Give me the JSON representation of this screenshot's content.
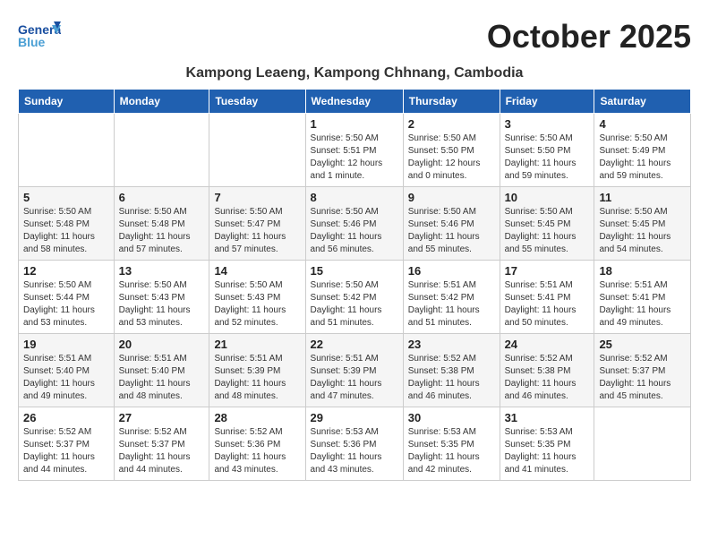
{
  "header": {
    "logo_line1": "General",
    "logo_line2": "Blue",
    "month_title": "October 2025",
    "location": "Kampong Leaeng, Kampong Chhnang, Cambodia"
  },
  "weekdays": [
    "Sunday",
    "Monday",
    "Tuesday",
    "Wednesday",
    "Thursday",
    "Friday",
    "Saturday"
  ],
  "weeks": [
    [
      {
        "day": "",
        "info": ""
      },
      {
        "day": "",
        "info": ""
      },
      {
        "day": "",
        "info": ""
      },
      {
        "day": "1",
        "info": "Sunrise: 5:50 AM\nSunset: 5:51 PM\nDaylight: 12 hours\nand 1 minute."
      },
      {
        "day": "2",
        "info": "Sunrise: 5:50 AM\nSunset: 5:50 PM\nDaylight: 12 hours\nand 0 minutes."
      },
      {
        "day": "3",
        "info": "Sunrise: 5:50 AM\nSunset: 5:50 PM\nDaylight: 11 hours\nand 59 minutes."
      },
      {
        "day": "4",
        "info": "Sunrise: 5:50 AM\nSunset: 5:49 PM\nDaylight: 11 hours\nand 59 minutes."
      }
    ],
    [
      {
        "day": "5",
        "info": "Sunrise: 5:50 AM\nSunset: 5:48 PM\nDaylight: 11 hours\nand 58 minutes."
      },
      {
        "day": "6",
        "info": "Sunrise: 5:50 AM\nSunset: 5:48 PM\nDaylight: 11 hours\nand 57 minutes."
      },
      {
        "day": "7",
        "info": "Sunrise: 5:50 AM\nSunset: 5:47 PM\nDaylight: 11 hours\nand 57 minutes."
      },
      {
        "day": "8",
        "info": "Sunrise: 5:50 AM\nSunset: 5:46 PM\nDaylight: 11 hours\nand 56 minutes."
      },
      {
        "day": "9",
        "info": "Sunrise: 5:50 AM\nSunset: 5:46 PM\nDaylight: 11 hours\nand 55 minutes."
      },
      {
        "day": "10",
        "info": "Sunrise: 5:50 AM\nSunset: 5:45 PM\nDaylight: 11 hours\nand 55 minutes."
      },
      {
        "day": "11",
        "info": "Sunrise: 5:50 AM\nSunset: 5:45 PM\nDaylight: 11 hours\nand 54 minutes."
      }
    ],
    [
      {
        "day": "12",
        "info": "Sunrise: 5:50 AM\nSunset: 5:44 PM\nDaylight: 11 hours\nand 53 minutes."
      },
      {
        "day": "13",
        "info": "Sunrise: 5:50 AM\nSunset: 5:43 PM\nDaylight: 11 hours\nand 53 minutes."
      },
      {
        "day": "14",
        "info": "Sunrise: 5:50 AM\nSunset: 5:43 PM\nDaylight: 11 hours\nand 52 minutes."
      },
      {
        "day": "15",
        "info": "Sunrise: 5:50 AM\nSunset: 5:42 PM\nDaylight: 11 hours\nand 51 minutes."
      },
      {
        "day": "16",
        "info": "Sunrise: 5:51 AM\nSunset: 5:42 PM\nDaylight: 11 hours\nand 51 minutes."
      },
      {
        "day": "17",
        "info": "Sunrise: 5:51 AM\nSunset: 5:41 PM\nDaylight: 11 hours\nand 50 minutes."
      },
      {
        "day": "18",
        "info": "Sunrise: 5:51 AM\nSunset: 5:41 PM\nDaylight: 11 hours\nand 49 minutes."
      }
    ],
    [
      {
        "day": "19",
        "info": "Sunrise: 5:51 AM\nSunset: 5:40 PM\nDaylight: 11 hours\nand 49 minutes."
      },
      {
        "day": "20",
        "info": "Sunrise: 5:51 AM\nSunset: 5:40 PM\nDaylight: 11 hours\nand 48 minutes."
      },
      {
        "day": "21",
        "info": "Sunrise: 5:51 AM\nSunset: 5:39 PM\nDaylight: 11 hours\nand 48 minutes."
      },
      {
        "day": "22",
        "info": "Sunrise: 5:51 AM\nSunset: 5:39 PM\nDaylight: 11 hours\nand 47 minutes."
      },
      {
        "day": "23",
        "info": "Sunrise: 5:52 AM\nSunset: 5:38 PM\nDaylight: 11 hours\nand 46 minutes."
      },
      {
        "day": "24",
        "info": "Sunrise: 5:52 AM\nSunset: 5:38 PM\nDaylight: 11 hours\nand 46 minutes."
      },
      {
        "day": "25",
        "info": "Sunrise: 5:52 AM\nSunset: 5:37 PM\nDaylight: 11 hours\nand 45 minutes."
      }
    ],
    [
      {
        "day": "26",
        "info": "Sunrise: 5:52 AM\nSunset: 5:37 PM\nDaylight: 11 hours\nand 44 minutes."
      },
      {
        "day": "27",
        "info": "Sunrise: 5:52 AM\nSunset: 5:37 PM\nDaylight: 11 hours\nand 44 minutes."
      },
      {
        "day": "28",
        "info": "Sunrise: 5:52 AM\nSunset: 5:36 PM\nDaylight: 11 hours\nand 43 minutes."
      },
      {
        "day": "29",
        "info": "Sunrise: 5:53 AM\nSunset: 5:36 PM\nDaylight: 11 hours\nand 43 minutes."
      },
      {
        "day": "30",
        "info": "Sunrise: 5:53 AM\nSunset: 5:35 PM\nDaylight: 11 hours\nand 42 minutes."
      },
      {
        "day": "31",
        "info": "Sunrise: 5:53 AM\nSunset: 5:35 PM\nDaylight: 11 hours\nand 41 minutes."
      },
      {
        "day": "",
        "info": ""
      }
    ]
  ]
}
